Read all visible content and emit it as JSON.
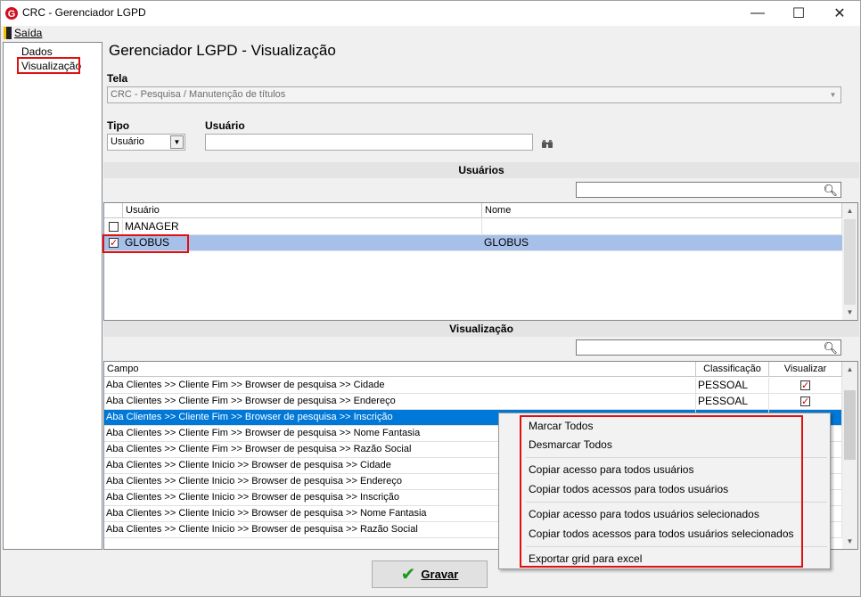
{
  "window": {
    "title": "CRC - Gerenciador LGPD",
    "minimize": "—",
    "maximize": "☐",
    "close": "✕"
  },
  "menu": {
    "exit_label": "Saída"
  },
  "nav": {
    "items": [
      "Dados",
      "Visualização"
    ]
  },
  "page": {
    "heading": "Gerenciador LGPD - Visualização"
  },
  "tela": {
    "label": "Tela",
    "value": "CRC - Pesquisa / Manutenção de títulos"
  },
  "tipo": {
    "label": "Tipo",
    "value": "Usuário"
  },
  "usuario_field": {
    "label": "Usuário",
    "value": ""
  },
  "usuarios": {
    "header": "Usuários",
    "search_value": "",
    "columns": [
      "Usuário",
      "Nome"
    ],
    "rows": [
      {
        "checked": false,
        "usuario": "MANAGER",
        "nome": ""
      },
      {
        "checked": true,
        "usuario": "GLOBUS",
        "nome": "GLOBUS"
      }
    ]
  },
  "visualizacao": {
    "header": "Visualização",
    "search_value": "",
    "columns": [
      "Campo",
      "Classificação",
      "Visualizar"
    ],
    "rows": [
      {
        "campo": "Aba Clientes >> Cliente Fim >> Browser de pesquisa >> Cidade",
        "classificacao": "PESSOAL",
        "visualizar": true
      },
      {
        "campo": "Aba Clientes >> Cliente Fim >> Browser de pesquisa >> Endereço",
        "classificacao": "PESSOAL",
        "visualizar": true
      },
      {
        "campo": "Aba Clientes >> Cliente Fim >> Browser de pesquisa >> Inscrição",
        "classificacao": "",
        "visualizar": null
      },
      {
        "campo": "Aba Clientes >> Cliente Fim >> Browser de pesquisa >> Nome Fantasia",
        "classificacao": "",
        "visualizar": null
      },
      {
        "campo": "Aba Clientes >> Cliente Fim >> Browser de pesquisa >> Razão Social",
        "classificacao": "",
        "visualizar": null
      },
      {
        "campo": "Aba Clientes >> Cliente Inicio >> Browser de pesquisa >> Cidade",
        "classificacao": "",
        "visualizar": null
      },
      {
        "campo": "Aba Clientes >> Cliente Inicio >> Browser de pesquisa >> Endereço",
        "classificacao": "",
        "visualizar": null
      },
      {
        "campo": "Aba Clientes >> Cliente Inicio >> Browser de pesquisa >> Inscrição",
        "classificacao": "",
        "visualizar": null
      },
      {
        "campo": "Aba Clientes >> Cliente Inicio >> Browser de pesquisa >> Nome Fantasia",
        "classificacao": "",
        "visualizar": null
      },
      {
        "campo": "Aba Clientes >> Cliente Inicio >> Browser de pesquisa >> Razão Social",
        "classificacao": "",
        "visualizar": null
      }
    ]
  },
  "context_menu": {
    "items": [
      "Marcar Todos",
      "Desmarcar Todos",
      "Copiar acesso para todos usuários",
      "Copiar todos acessos para todos usuários",
      "Copiar acesso para todos usuários selecionados",
      "Copiar todos acessos para todos usuários selecionados",
      "Exportar grid para excel"
    ]
  },
  "footer": {
    "save_label": "Gravar"
  },
  "colors": {
    "selection": "#0078d7",
    "selected_row": "#a6c0ea",
    "highlight": "#e01010",
    "accent_icon": "#d01020",
    "save_check": "#1a9a1a"
  }
}
